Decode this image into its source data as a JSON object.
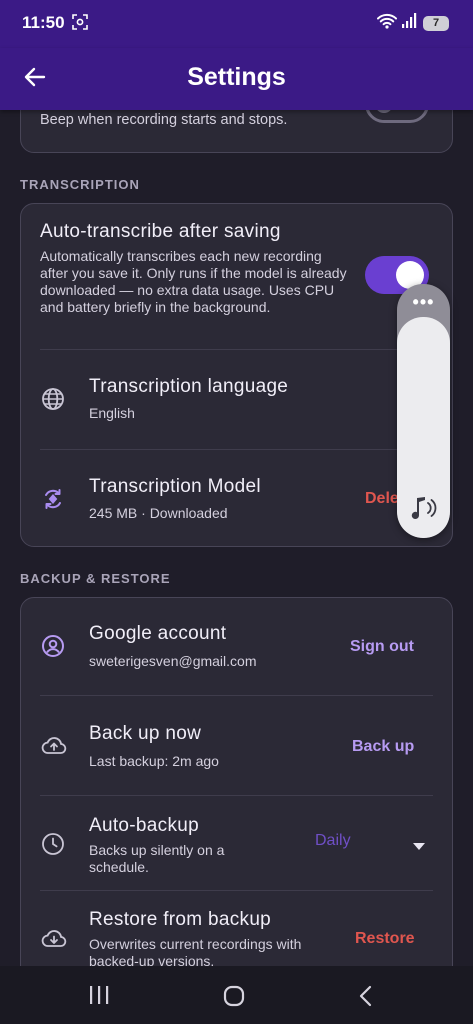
{
  "status": {
    "time": "11:50",
    "battery": "7"
  },
  "appbar": {
    "title": "Settings"
  },
  "sound": {
    "beep_desc": "Beep when recording starts and stops."
  },
  "transcription": {
    "section_label": "TRANSCRIPTION",
    "auto": {
      "title": "Auto-transcribe after saving",
      "desc": "Automatically transcribes each new recording after you save it. Only runs if the model is already downloaded — no extra data usage. Uses CPU and battery briefly in the background."
    },
    "language": {
      "title": "Transcription language",
      "value": "English"
    },
    "model": {
      "title": "Transcription Model",
      "value": "245 MB · Downloaded",
      "action": "Dele"
    }
  },
  "backup": {
    "section_label": "BACKUP & RESTORE",
    "google": {
      "title": "Google account",
      "value": "sweterigesven@gmail.com",
      "action": "Sign out"
    },
    "backup_now": {
      "title": "Back up now",
      "value": "Last backup: 2m ago",
      "action": "Back up"
    },
    "auto_backup": {
      "title": "Auto-backup",
      "value": "Backs up silently on a schedule.",
      "selected": "Daily"
    },
    "restore": {
      "title": "Restore from backup",
      "value": "Overwrites current recordings with backed-up versions.",
      "action": "Restore"
    }
  },
  "volume_overlay": {
    "level": 0.87,
    "more": "•••"
  },
  "colors": {
    "accent": "#6a3fd1",
    "action": "#b79bf2",
    "danger": "#e0564f",
    "appbar": "#3b1a86"
  }
}
